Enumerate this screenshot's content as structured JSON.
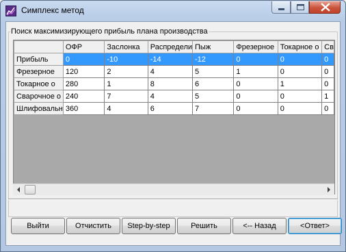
{
  "window": {
    "title": "Симплекс метод"
  },
  "group": {
    "legend": "Поиск максимизирующего прибыль плана производства"
  },
  "table": {
    "columns": [
      "ОФР",
      "Заслонка",
      "Распредели",
      "Пыж",
      "Фрезерное",
      "Токарное о",
      "Св"
    ],
    "rows": [
      {
        "label": "Прибыль",
        "cells": [
          "0",
          "-10",
          "-14",
          "-12",
          "0",
          "0",
          "0"
        ]
      },
      {
        "label": "Фрезерное",
        "cells": [
          "120",
          "2",
          "4",
          "5",
          "1",
          "0",
          "0"
        ]
      },
      {
        "label": "Токарное о",
        "cells": [
          "280",
          "1",
          "8",
          "6",
          "0",
          "1",
          "0"
        ]
      },
      {
        "label": "Сварочное о",
        "cells": [
          "240",
          "7",
          "4",
          "5",
          "0",
          "0",
          "1"
        ]
      },
      {
        "label": "Шлифовальн",
        "cells": [
          "360",
          "4",
          "6",
          "7",
          "0",
          "0",
          "0"
        ]
      }
    ]
  },
  "buttons": {
    "exit": "Выйти",
    "clear": "Отчистить",
    "step": "Step-by-step",
    "solve": "Решить",
    "back": "<-- Назад",
    "answer": "<Ответ>"
  },
  "icons": {
    "app": "chart-line-icon",
    "minimize": "minimize-icon",
    "maximize": "maximize-icon",
    "close": "close-icon",
    "scroll_left": "chevron-left-icon",
    "scroll_right": "chevron-right-icon"
  },
  "colors": {
    "selection": "#3399ff",
    "close_button": "#c9533c",
    "title_bar": "#b9cde7"
  }
}
